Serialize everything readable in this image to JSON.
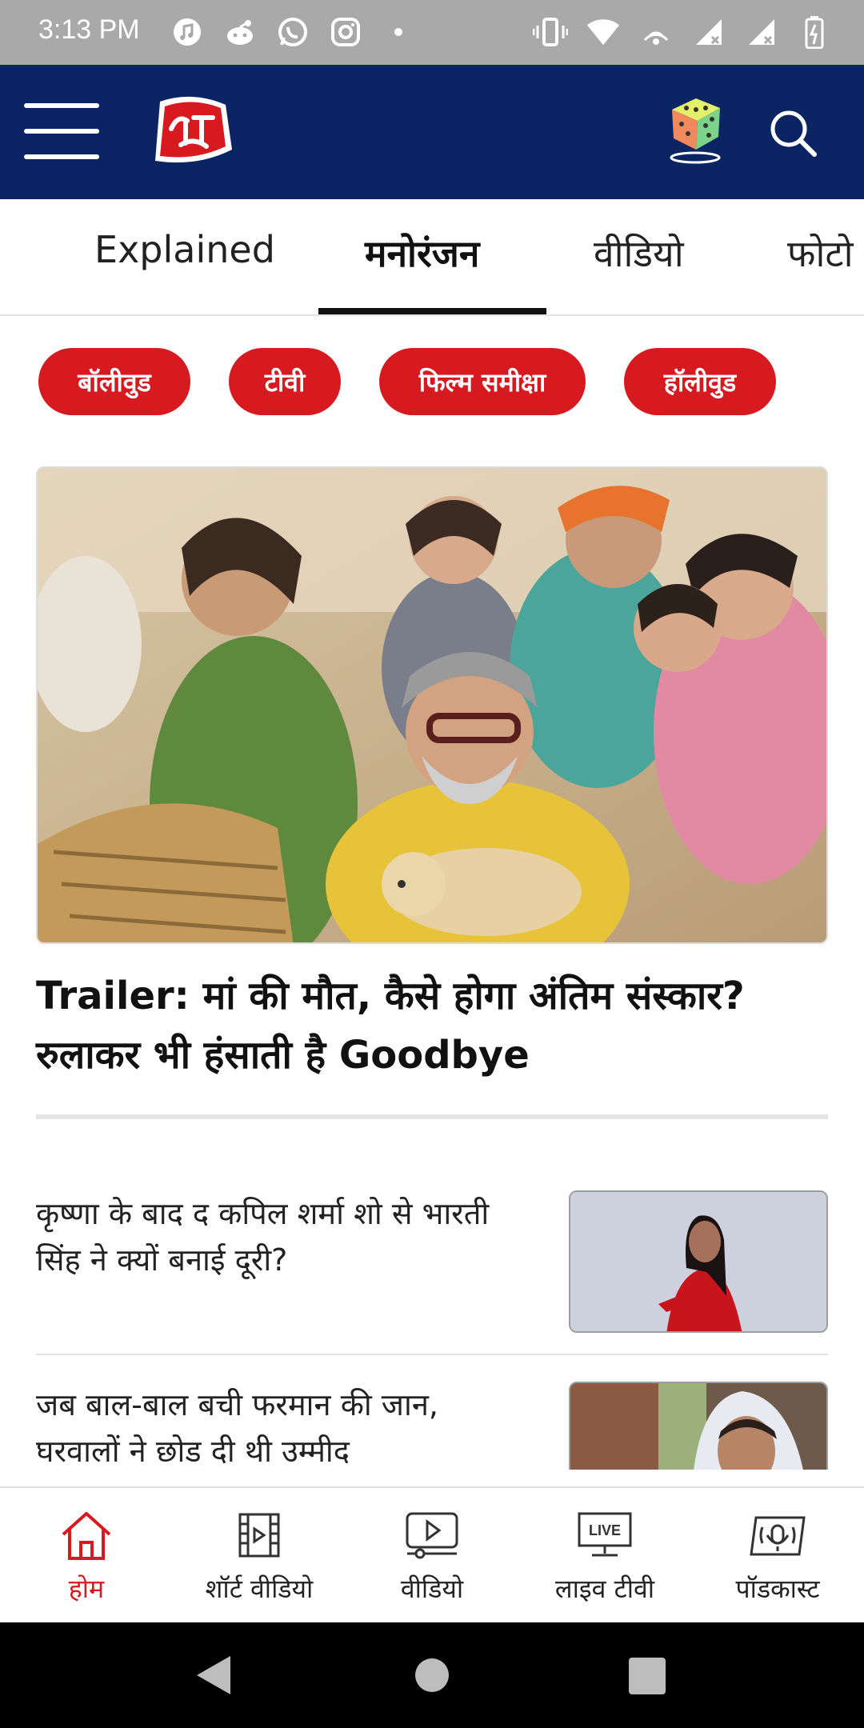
{
  "status_bar": {
    "time": "3:13 PM"
  },
  "header": {
    "logo_text": "आज तक"
  },
  "tabs": [
    {
      "label": "Explained"
    },
    {
      "label": "मनोरंजन"
    },
    {
      "label": "वीडियो"
    },
    {
      "label": "फोटो"
    }
  ],
  "chips": [
    {
      "label": "बॉलीवुड"
    },
    {
      "label": "टीवी"
    },
    {
      "label": "फिल्म समीक्षा"
    },
    {
      "label": "हॉलीवुड"
    }
  ],
  "hero": {
    "title": "Trailer: मां की मौत, कैसे होगा अंतिम संस्कार? रुलाकर भी हंसाती है Goodbye"
  },
  "stories": [
    {
      "title": "कृष्णा के बाद द कपिल शर्मा शो से भारती सिंह ने क्यों बनाई दूरी?"
    },
    {
      "title": "जब बाल-बाल बची फरमान की जान, घरवालों ने छोड दी थी उम्मीद"
    }
  ],
  "bottom_nav": [
    {
      "label": "होम",
      "icon": "home-icon"
    },
    {
      "label": "शॉर्ट वीडियो",
      "icon": "film-icon"
    },
    {
      "label": "वीडियो",
      "icon": "video-play-icon"
    },
    {
      "label": "लाइव टीवी",
      "icon": "live-tv-icon",
      "badge": "LIVE"
    },
    {
      "label": "पॉडकास्ट",
      "icon": "podcast-icon"
    }
  ],
  "colors": {
    "header_bg": "#0b2564",
    "accent_red": "#d71920",
    "status_bar_bg": "#a9a9a9"
  }
}
